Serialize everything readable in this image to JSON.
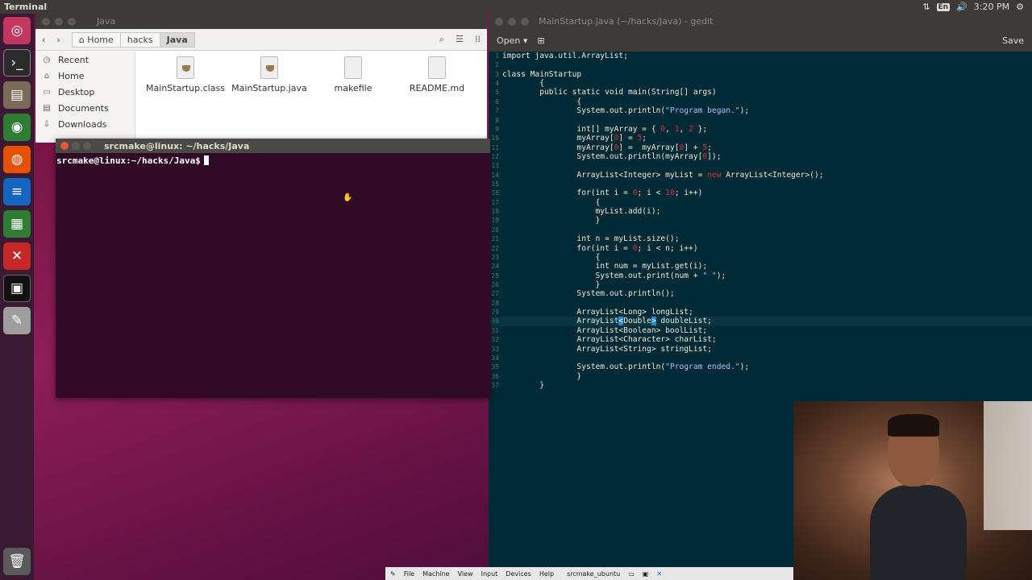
{
  "topbar": {
    "title": "Terminal",
    "lang": "En",
    "time": "3:20 PM"
  },
  "launcher": [
    "ubuntu-dash-icon",
    "terminal-icon",
    "files-icon",
    "chrome-icon",
    "firefox-icon",
    "writer-icon",
    "calc-icon",
    "settings-icon",
    "vbox-icon",
    "text-editor-icon"
  ],
  "files": {
    "title": "Java",
    "breadcrumb": [
      {
        "label": "Home"
      },
      {
        "label": "hacks"
      },
      {
        "label": "Java"
      }
    ],
    "sidebar": [
      {
        "label": "Recent",
        "icon": "clock-icon"
      },
      {
        "label": "Home",
        "icon": "home-icon"
      },
      {
        "label": "Desktop",
        "icon": "folder-icon"
      },
      {
        "label": "Documents",
        "icon": "documents-icon"
      },
      {
        "label": "Downloads",
        "icon": "download-icon"
      }
    ],
    "items": [
      {
        "name": "MainStartup.class",
        "type": "java"
      },
      {
        "name": "MainStartup.java",
        "type": "java"
      },
      {
        "name": "makefile",
        "type": "text"
      },
      {
        "name": "README.md",
        "type": "text"
      }
    ]
  },
  "terminal": {
    "title": "srcmake@linux: ~/hacks/Java",
    "prompt": "srcmake@linux:~/hacks/Java$"
  },
  "gedit": {
    "title": "MainStartup.java (~/hacks/Java) - gedit",
    "open_label": "Open",
    "save_label": "Save",
    "current_line": 30
  },
  "vbox": {
    "menus": [
      "File",
      "Machine",
      "View",
      "Input",
      "Devices",
      "Help"
    ],
    "vm_name": "srcmake_ubuntu"
  },
  "colors": {
    "accent": "#dc322f",
    "editor_bg": "#002b36",
    "terminal_bg": "#300a24"
  }
}
